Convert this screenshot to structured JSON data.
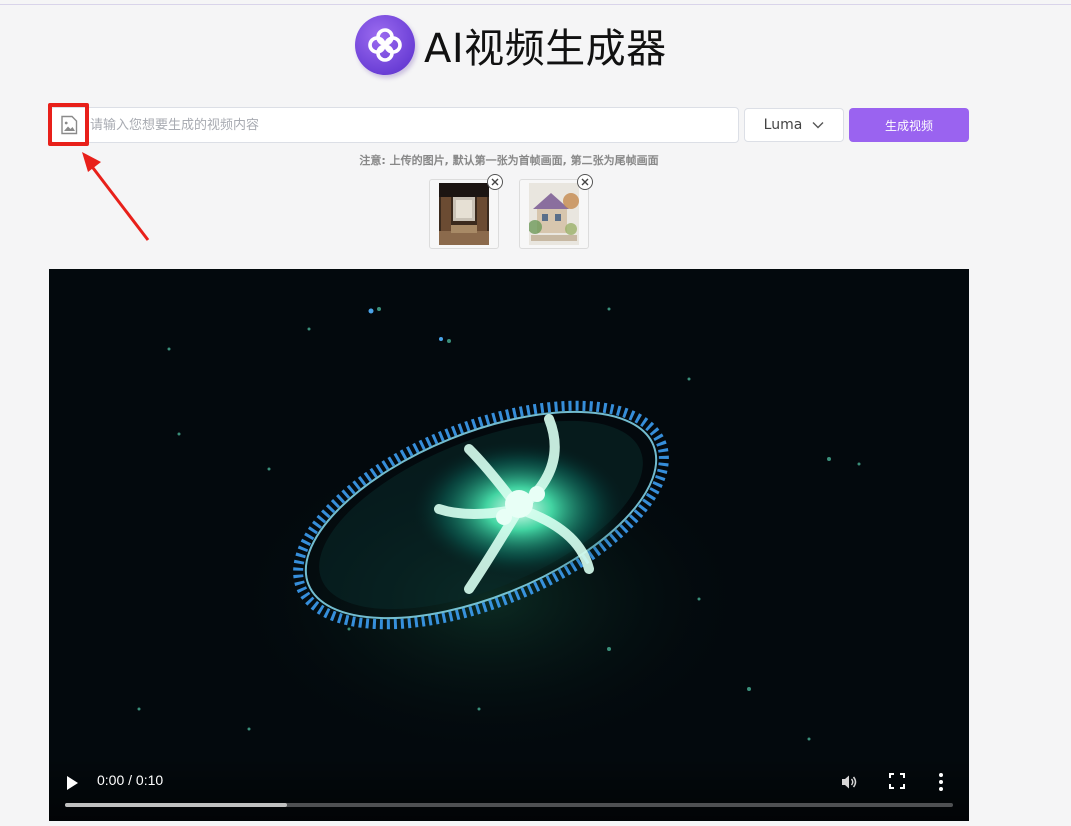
{
  "app": {
    "title": "AI视频生成器"
  },
  "prompt": {
    "placeholder": "请输入您想要生成的视频内容",
    "value": ""
  },
  "model_select": {
    "selected": "Luma"
  },
  "generate_button": {
    "label": "生成视频"
  },
  "note": "注意: 上传的图片, 默认第一张为首帧画面, 第二张为尾帧画面",
  "uploads": [
    {
      "icon": "interior-room-thumbnail"
    },
    {
      "icon": "watercolor-house-thumbnail"
    }
  ],
  "player": {
    "time": "0:00 / 0:10",
    "progress_fraction": 0.25
  },
  "colors": {
    "accent": "#9a63f0",
    "highlight": "#e8201a",
    "background": "#f5f5f6"
  },
  "icons": [
    "logo-icon",
    "image-upload-icon",
    "chevron-down-icon",
    "close-icon",
    "play-icon",
    "volume-icon",
    "fullscreen-icon",
    "more-options-icon"
  ]
}
